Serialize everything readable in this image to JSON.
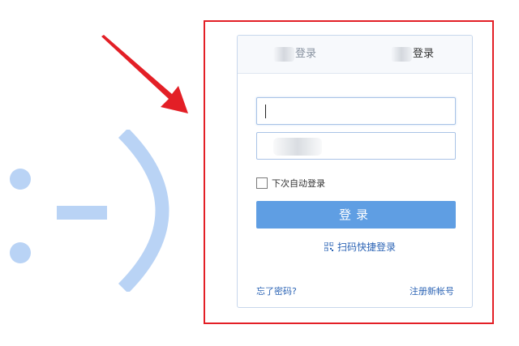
{
  "decor": {
    "emoticon_color": "#b9d3f5",
    "arrow_color": "#e31f26",
    "frame_color": "#e31f26"
  },
  "login": {
    "tabs": [
      {
        "label": "登录",
        "active": false
      },
      {
        "label": "登录",
        "active": true
      }
    ],
    "account_input": {
      "value": "",
      "placeholder": ""
    },
    "password_input": {
      "value": "",
      "placeholder": ""
    },
    "remember_label": "下次自动登录",
    "remember_checked": false,
    "login_button": "登录",
    "qr_login": "扫码快捷登录",
    "forgot_password": "忘了密码?",
    "register": "注册新帐号",
    "accent_color": "#5f9ee3",
    "link_color": "#2c64b5"
  }
}
